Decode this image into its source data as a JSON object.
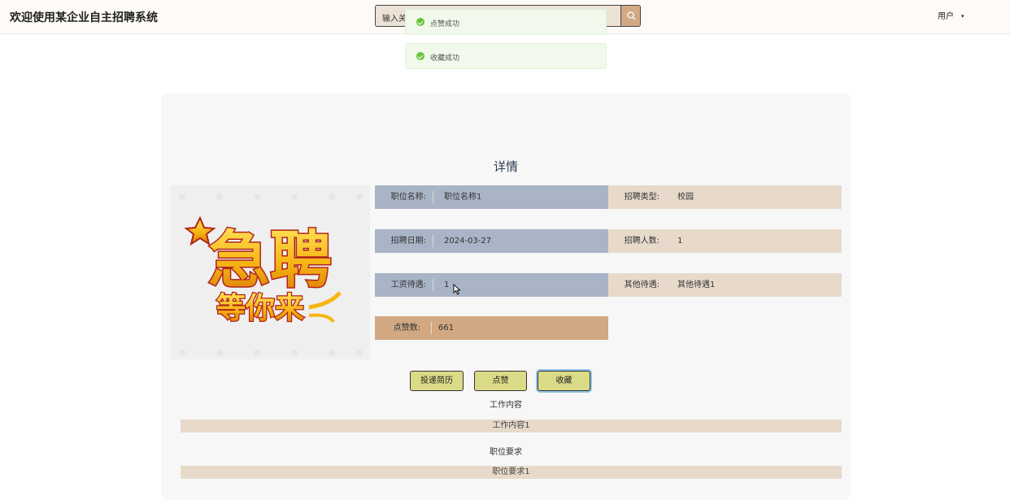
{
  "header": {
    "title": "欢迎使用某企业自主招聘系统",
    "search_value": "输入关",
    "search_icon": "search-icon",
    "user_label": "用户",
    "user_caret": "▾"
  },
  "toasts": [
    {
      "text": "点赞成功",
      "type": "success"
    },
    {
      "text": "收藏成功",
      "type": "success"
    }
  ],
  "detail": {
    "heading": "详情",
    "fields": {
      "position_name": {
        "label": "职位名称:",
        "value": "职位名称1"
      },
      "recruit_type": {
        "label": "招聘类型:",
        "value": "校园"
      },
      "recruit_date": {
        "label": "招聘日期:",
        "value": "2024-03-27"
      },
      "recruit_count": {
        "label": "招聘人数:",
        "value": "1"
      },
      "salary": {
        "label": "工资待遇:",
        "value": "1"
      },
      "other_benefits": {
        "label": "其他待遇:",
        "value": "其他待遇1"
      },
      "likes": {
        "label": "点赞数:",
        "value": "661"
      }
    },
    "poster_text": {
      "line1": "急聘",
      "line2": "等你来"
    },
    "buttons": {
      "apply": "投递简历",
      "like": "点赞",
      "favorite": "收藏"
    },
    "sections": {
      "job_content_title": "工作内容",
      "job_content_value": "工作内容1",
      "job_requirements_title": "职位要求",
      "job_requirements_value": "职位要求1"
    }
  },
  "colors": {
    "field_blue": "#a9b4c6",
    "field_tan": "#e8dacb",
    "field_orange": "#d1a882",
    "button_yellow": "#dbda86",
    "toast_success": "#67c23a"
  }
}
